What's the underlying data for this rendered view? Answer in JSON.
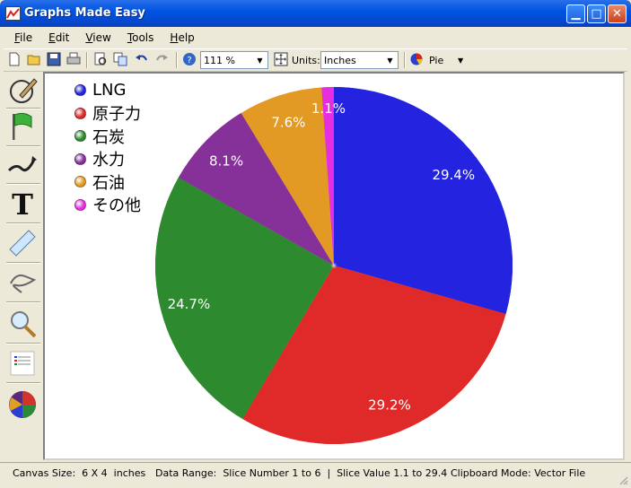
{
  "window": {
    "title": "Graphs Made Easy"
  },
  "menu": [
    {
      "first": "F",
      "rest": "ile"
    },
    {
      "first": "E",
      "rest": "dit"
    },
    {
      "first": "V",
      "rest": "iew"
    },
    {
      "first": "T",
      "rest": "ools"
    },
    {
      "first": "H",
      "rest": "elp"
    }
  ],
  "toolbar": {
    "zoom": "111 %",
    "units_label": "Units:",
    "units_value": "Inches",
    "chart_type": "Pie"
  },
  "status": {
    "canvas_size": "Canvas Size:  6 X 4  inches",
    "data_range": "Data Range:  Slice Number 1 to 6  |  Slice Value 1.1 to 29.4",
    "clipboard": "Clipboard Mode: Vector File"
  },
  "colors": {
    "lng": "#2323e0",
    "nuclear": "#e02a2a",
    "coal": "#2e8a2e",
    "hydro": "#86309a",
    "oil": "#e39a24",
    "other": "#e52ee0"
  },
  "chart_data": {
    "type": "pie",
    "labels": [
      "LNG",
      "原子力",
      "石炭",
      "水力",
      "石油",
      "その他"
    ],
    "values": [
      29.4,
      29.2,
      24.7,
      8.1,
      7.6,
      1.1
    ],
    "value_labels": [
      "29.4%",
      "29.2%",
      "24.7%",
      "8.1%",
      "7.6%",
      "1.1%"
    ],
    "colors": [
      "#2323e0",
      "#e02a2a",
      "#2e8a2e",
      "#86309a",
      "#e39a24",
      "#e52ee0"
    ],
    "legend_position": "top-left"
  }
}
